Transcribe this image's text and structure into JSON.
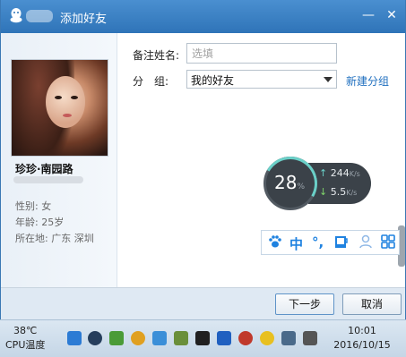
{
  "title": "添加好友",
  "form": {
    "remark_label": "备注姓名:",
    "remark_placeholder": "选填",
    "group_label": "分　组:",
    "group_value": "我的好友",
    "new_group_link": "新建分组"
  },
  "profile": {
    "nickname": "珍珍·南园路",
    "gender": "性别: 女",
    "age": "年龄: 25岁",
    "location": "所在地: 广东  深圳"
  },
  "buttons": {
    "next": "下一步",
    "cancel": "取消"
  },
  "monitor": {
    "percent": "28",
    "percent_unit": "%",
    "upload": "244",
    "upload_unit": "K/s",
    "download": "5.5",
    "download_unit": "K/s"
  },
  "ime": {
    "items": [
      "paw-icon",
      "中",
      "°,",
      "cup-icon",
      "user-icon",
      "grid-icon"
    ]
  },
  "taskbar": {
    "temp": "38℃",
    "temp_label": "CPU温度",
    "time": "10:01",
    "date": "2016/10/15",
    "colors": [
      "#2c7bd4",
      "#263e5c",
      "#4a9b37",
      "#e0a020",
      "#3b8fd8",
      "#6a8f3a",
      "#202020",
      "#2060c0",
      "#c0392b",
      "#2a2a2a",
      "#5aa02c",
      "#4a6a8a",
      "#555555"
    ]
  }
}
